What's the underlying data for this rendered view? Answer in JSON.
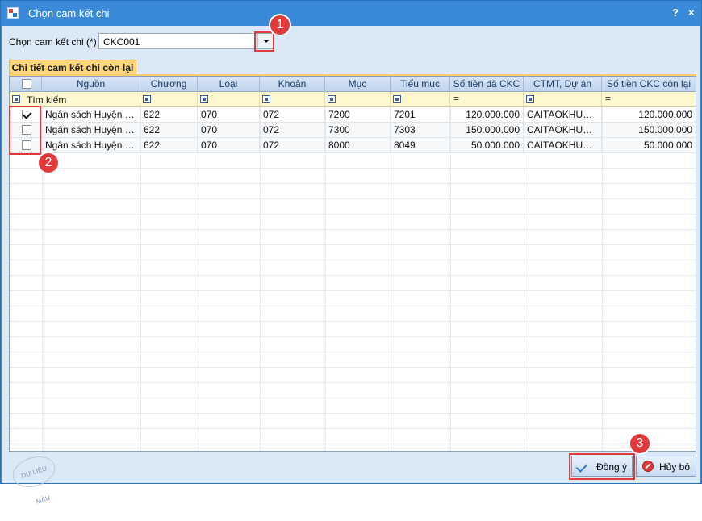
{
  "window": {
    "title": "Chọn cam kết chi",
    "help": "?",
    "close": "×"
  },
  "selector": {
    "label": "Chọn cam kết chi (*)",
    "value": "CKC001"
  },
  "tab": {
    "label": "Chi tiết cam kết chi còn lại"
  },
  "grid": {
    "headers": [
      "Nguồn",
      "Chương",
      "Loại",
      "Khoản",
      "Mục",
      "Tiểu mục",
      "Số tiền đã CKC",
      "CTMT, Dự án",
      "Số tiền CKC còn lại"
    ],
    "filter": {
      "search_text": "Tìm kiếm",
      "eq_symbol": "="
    },
    "rows": [
      {
        "checked": true,
        "nguon": "Ngân sách Huyện tự...",
        "chuong": "622",
        "loai": "070",
        "khoan": "072",
        "muc": "7200",
        "tieu_muc": "7201",
        "so_tien_da_ckc": "120.000.000",
        "ctmt": "CAITAOKHUON...",
        "con_lai": "120.000.000"
      },
      {
        "checked": false,
        "nguon": "Ngân sách Huyện tự...",
        "chuong": "622",
        "loai": "070",
        "khoan": "072",
        "muc": "7300",
        "tieu_muc": "7303",
        "so_tien_da_ckc": "150.000.000",
        "ctmt": "CAITAOKHUON...",
        "con_lai": "150.000.000"
      },
      {
        "checked": false,
        "nguon": "Ngân sách Huyện tự...",
        "chuong": "622",
        "loai": "070",
        "khoan": "072",
        "muc": "8000",
        "tieu_muc": "8049",
        "so_tien_da_ckc": "50.000.000",
        "ctmt": "CAITAOKHUON...",
        "con_lai": "50.000.000"
      }
    ]
  },
  "buttons": {
    "ok": "Đồng ý",
    "cancel": "Hủy bỏ"
  },
  "callouts": {
    "one": "1",
    "two": "2",
    "three": "3"
  },
  "watermark": "DỰ LIỆU MÀU",
  "colors": {
    "title_bar": "#3b8ad9",
    "client_bg": "#dbe8f6",
    "tab_bg": "#fbd779",
    "filter_row": "#fff7cf",
    "callout": "#e23a3a"
  }
}
